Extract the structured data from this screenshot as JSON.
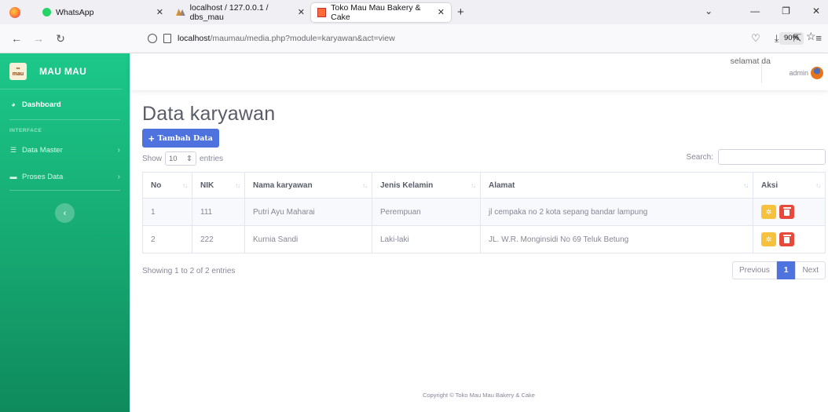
{
  "browser": {
    "tabs": [
      {
        "label": "WhatsApp"
      },
      {
        "label": "localhost / 127.0.0.1 / dbs_mau"
      },
      {
        "label": "Toko Mau Mau Bakery & Cake"
      }
    ],
    "url_host": "localhost",
    "url_path": "/maumau/media.php?module=karyawan&act=view",
    "zoom": "90%"
  },
  "sidebar": {
    "brand": "MAU MAU",
    "logo_text": "mau mau",
    "dashboard": "Dashboard",
    "heading": "INTERFACE",
    "items": [
      {
        "label": "Data Master"
      },
      {
        "label": "Proses Data"
      }
    ]
  },
  "topbar": {
    "greeting": "selamat da",
    "user": "admin"
  },
  "main": {
    "title": "Data karyawan",
    "add_button": "Tambah Data",
    "show_label": "Show",
    "entries_value": "10",
    "entries_label": "entries",
    "search_label": "Search:",
    "columns": [
      "No",
      "NIK",
      "Nama karyawan",
      "Jenis Kelamin",
      "Alamat",
      "Aksi"
    ],
    "rows": [
      {
        "no": "1",
        "nik": "111",
        "nama": "Putri Ayu Maharai",
        "jk": "Perempuan",
        "alamat": "jl cempaka no 2 kota sepang bandar lampung"
      },
      {
        "no": "2",
        "nik": "222",
        "nama": "Kurnia Sandi",
        "jk": "Laki-laki",
        "alamat": "JL. W.R. Monginsidi No 69 Teluk Betung"
      }
    ],
    "info": "Showing 1 to 2 of 2 entries",
    "pagination": {
      "prev": "Previous",
      "current": "1",
      "next": "Next"
    }
  },
  "footer": "Copyright © Toko Mau Mau Bakery & Cake",
  "colors": {
    "sidebar": "#1cc88a",
    "primary": "#4e73df",
    "warning": "#f6c23e",
    "danger": "#e74a3b"
  }
}
